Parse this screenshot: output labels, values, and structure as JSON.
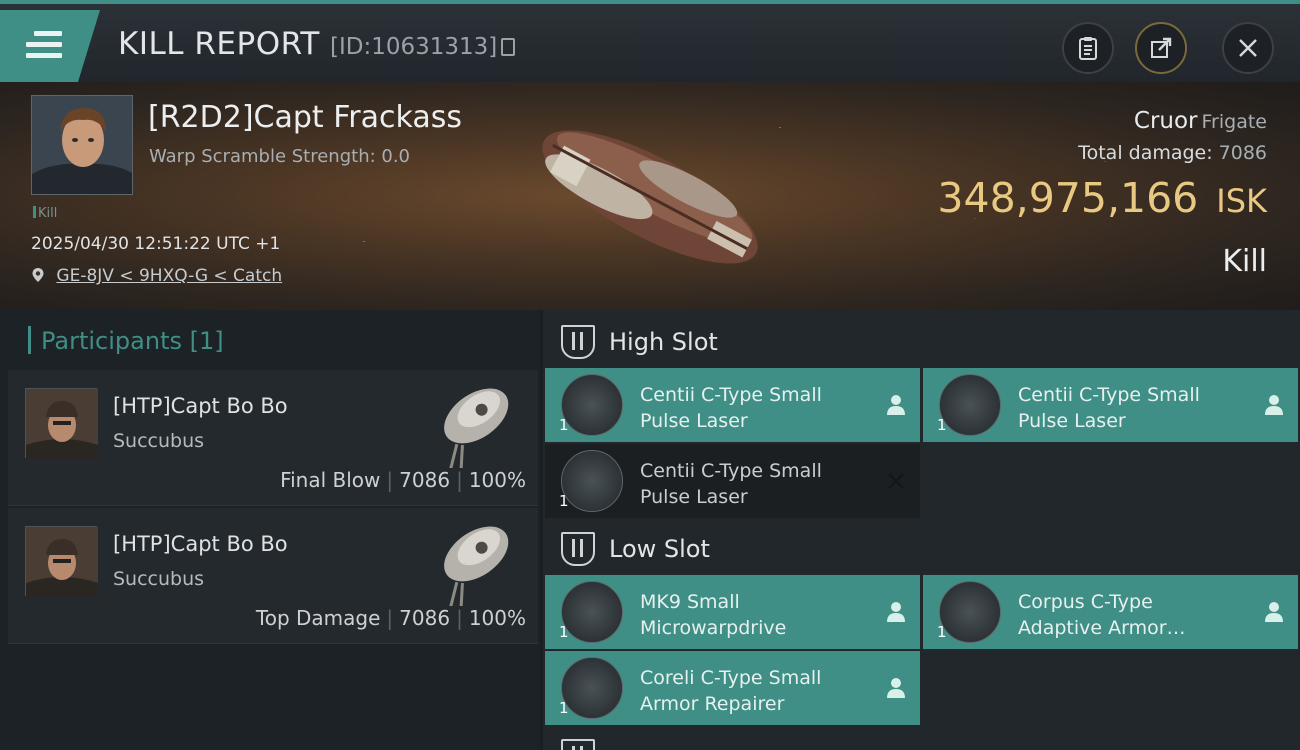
{
  "header": {
    "title": "KILL REPORT",
    "report_id": "[ID:10631313]"
  },
  "victim": {
    "name": "[R2D2]Capt Frackass",
    "warp_scramble": "Warp Scramble Strength: 0.0",
    "kill_tag": "Kill",
    "datetime": "2025/04/30 12:51:22 UTC +1",
    "location": "GE-8JV < 9HXQ-G < Catch",
    "ship_name": "Cruor",
    "ship_class": "Frigate",
    "total_damage_label": "Total damage:",
    "total_damage_value": "7086",
    "isk_value": "348,975,166",
    "isk_unit": "ISK",
    "result": "Kill"
  },
  "participants": {
    "label": "Participants",
    "count": "[1]",
    "items": [
      {
        "name": "[HTP]Capt Bo Bo",
        "ship": "Succubus",
        "role": "Final Blow",
        "damage": "7086",
        "percent": "100%"
      },
      {
        "name": "[HTP]Capt Bo Bo",
        "ship": "Succubus",
        "role": "Top Damage",
        "damage": "7086",
        "percent": "100%"
      }
    ]
  },
  "fitting": {
    "high_slot": {
      "label": "High Slot",
      "modules": [
        {
          "line1": "Centii C-Type Small",
          "line2": "Pulse Laser",
          "qty": "1",
          "status": "dropped"
        },
        {
          "line1": "Centii C-Type Small",
          "line2": "Pulse Laser",
          "qty": "1",
          "status": "dropped"
        },
        {
          "line1": "Centii C-Type Small",
          "line2": "Pulse Laser",
          "qty": "1",
          "status": "destroyed"
        }
      ]
    },
    "low_slot": {
      "label": "Low Slot",
      "modules": [
        {
          "line1": "MK9 Small",
          "line2": "Microwarpdrive",
          "qty": "1",
          "status": "dropped"
        },
        {
          "line1": "Corpus C-Type",
          "line2": "Adaptive Armor…",
          "qty": "1",
          "status": "dropped"
        },
        {
          "line1": "Coreli C-Type Small",
          "line2": "Armor Repairer",
          "qty": "1",
          "status": "dropped"
        }
      ]
    }
  },
  "colors": {
    "accent": "#3f8f86",
    "isk": "#e9c982",
    "background": "#1a1f24"
  },
  "icons": {
    "menu": "hamburger-icon",
    "copy": "copy-icon",
    "clipboard": "clipboard-icon",
    "share": "share-icon",
    "close": "close-icon",
    "location": "location-pin-icon",
    "slot": "slot-icon",
    "dropped": "person-icon",
    "destroyed": "x-mark-icon"
  }
}
